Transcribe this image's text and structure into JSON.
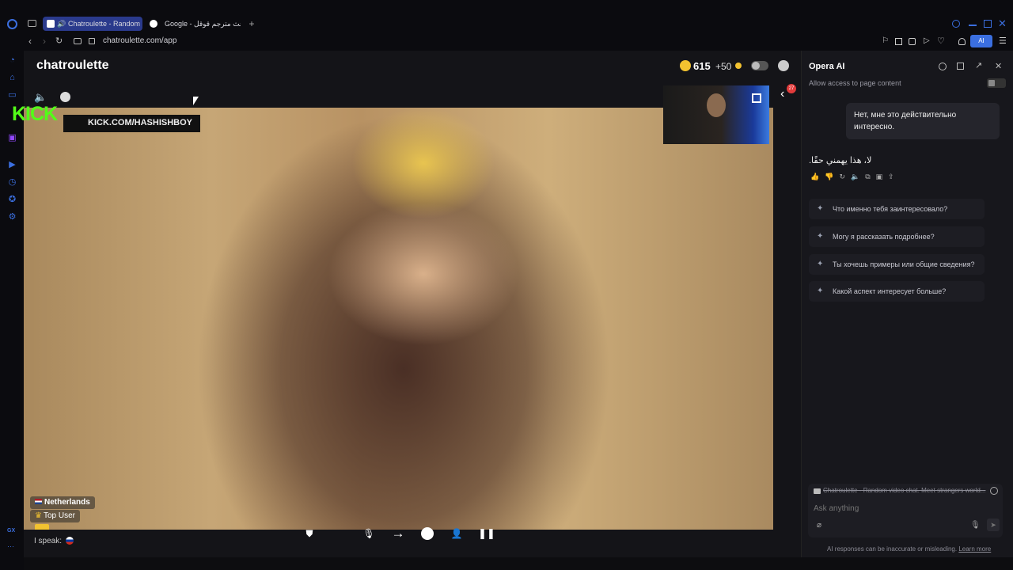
{
  "browser": {
    "tabs": [
      {
        "label": "Chatroulette - Random",
        "active": true
      },
      {
        "label": "Google - بحث مترجم قوقل",
        "active": false
      }
    ],
    "new_tab_label": "+",
    "url": "chatroulette.com/app",
    "ai_button_label": "AI",
    "sidebar_gx_label": "GX",
    "sidebar_more_label": "···"
  },
  "app": {
    "logo": "chatroulette",
    "coins": "615",
    "bonus": "+50",
    "notification_count": "27"
  },
  "overlay": {
    "kick_logo": "KICK",
    "kick_url": "KICK.COM/HASHISHBOY"
  },
  "partner": {
    "country": "Netherlands",
    "badge": "Top User",
    "speak_label": "I speak:"
  },
  "ai_panel": {
    "title": "Opera AI",
    "access_label": "Allow access to page content",
    "user_message": "Нет, мне это действительно интересно.",
    "ai_reply": "لا، هذا يهمني حقًا.",
    "suggestions": [
      "Что именно тебя заинтересовало?",
      "Могу я рассказать подробнее?",
      "Ты хочешь примеры или общие сведения?",
      "Какой аспект интересует больше?"
    ],
    "context_label": "Chatroulette - Random video chat. Meet strangers world...",
    "input_placeholder": "Ask anything",
    "disclaimer": "AI responses can be inaccurate or misleading.",
    "learn_more": "Learn more"
  },
  "colors": {
    "accent": "#3b6fe0",
    "kick_green": "#53fc18",
    "coin": "#f2c230"
  }
}
